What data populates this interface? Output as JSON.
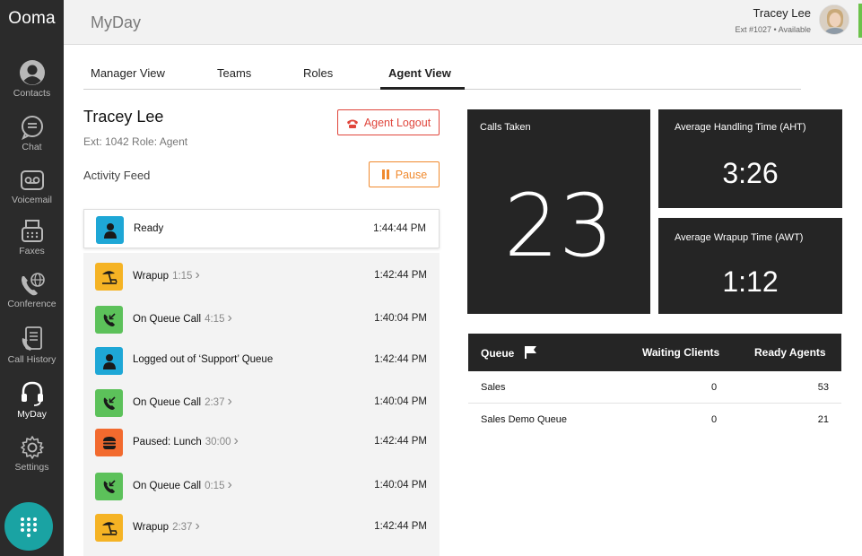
{
  "sidebar": {
    "brand": "Ooma",
    "items": [
      {
        "label": "Contacts"
      },
      {
        "label": "Chat"
      },
      {
        "label": "Voicemail"
      },
      {
        "label": "Faxes"
      },
      {
        "label": "Conference"
      },
      {
        "label": "Call History"
      },
      {
        "label": "MyDay",
        "active": true
      },
      {
        "label": "Settings"
      }
    ],
    "dialpad_icon": "dialpad-icon"
  },
  "header": {
    "title": "MyDay",
    "user_name": "Tracey Lee",
    "user_ext": "Ext #1027 • Available",
    "status_color": "#6cc24a"
  },
  "tabs": [
    {
      "label": "Manager View"
    },
    {
      "label": "Teams"
    },
    {
      "label": "Roles"
    },
    {
      "label": "Agent View",
      "active": true
    }
  ],
  "agent": {
    "name": "Tracey Lee",
    "meta": "Ext: 1042 Role: Agent",
    "logout_label": "Agent Logout",
    "activity_title": "Activity Feed",
    "pause_label": "Pause"
  },
  "feed": [
    {
      "label": "Ready",
      "duration": "",
      "time": "1:44:44 PM",
      "icon": "agent-icon",
      "color": "#1ea7d6",
      "chevron": false
    },
    {
      "label": "Wrapup",
      "duration": "1:15",
      "time": "1:42:44 PM",
      "icon": "beach-icon",
      "color": "#f5b324",
      "chevron": true
    },
    {
      "label": "On Queue Call",
      "duration": "4:15",
      "time": "1:40:04 PM",
      "icon": "phone-incoming-icon",
      "color": "#5cc15a",
      "chevron": true
    },
    {
      "label": "Logged out of ‘Support’ Queue",
      "duration": "",
      "time": "1:42:44 PM",
      "icon": "agent-icon",
      "color": "#1ea7d6",
      "chevron": false
    },
    {
      "label": "On Queue Call",
      "duration": "2:37",
      "time": "1:40:04 PM",
      "icon": "phone-incoming-icon",
      "color": "#5cc15a",
      "chevron": true
    },
    {
      "label": "Paused: Lunch",
      "duration": "30:00",
      "time": "1:42:44 PM",
      "icon": "burger-icon",
      "color": "#f26a2e",
      "chevron": true
    },
    {
      "label": "On Queue Call",
      "duration": "0:15",
      "time": "1:40:04 PM",
      "icon": "phone-incoming-icon",
      "color": "#5cc15a",
      "chevron": true
    },
    {
      "label": "Wrapup",
      "duration": "2:37",
      "time": "1:42:44 PM",
      "icon": "beach-icon",
      "color": "#f5b324",
      "chevron": true
    }
  ],
  "stats": {
    "calls_taken": {
      "label": "Calls Taken",
      "value": "23"
    },
    "aht": {
      "label": "Average Handling Time (AHT)",
      "value": "3:26"
    },
    "awt": {
      "label": "Average Wrapup Time (AWT)",
      "value": "1:12"
    }
  },
  "queue": {
    "headers": {
      "queue": "Queue",
      "waiting": "Waiting Clients",
      "ready": "Ready Agents"
    },
    "rows": [
      {
        "name": "Sales",
        "waiting": "0",
        "ready": "53"
      },
      {
        "name": "Sales Demo Queue",
        "waiting": "0",
        "ready": "21"
      }
    ]
  }
}
